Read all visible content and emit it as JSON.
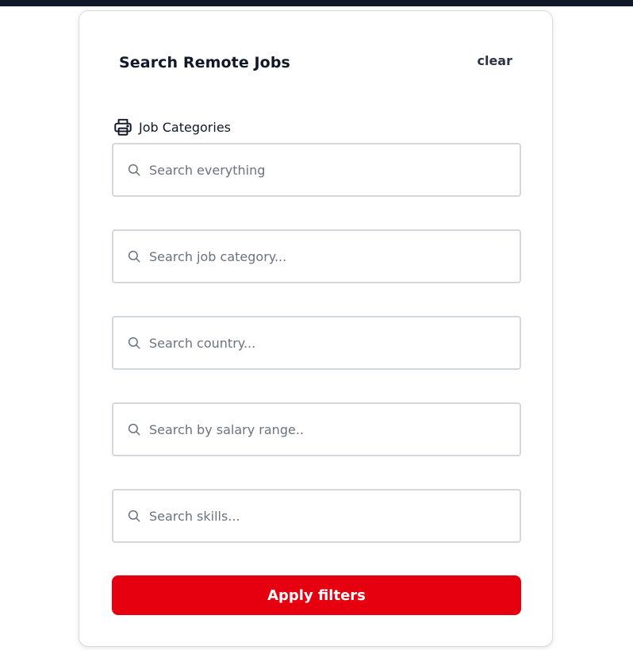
{
  "panel": {
    "title": "Search Remote Jobs",
    "clear_label": "clear"
  },
  "categories": {
    "label": "Job Categories",
    "icon": "printer-icon"
  },
  "fields": [
    {
      "name": "search-everything-input",
      "placeholder": "Search everything",
      "value": "",
      "icon": "search-icon"
    },
    {
      "name": "job-category-input",
      "placeholder": "Search job category...",
      "value": "",
      "icon": "search-icon"
    },
    {
      "name": "country-input",
      "placeholder": "Search country...",
      "value": "",
      "icon": "search-icon"
    },
    {
      "name": "salary-range-input",
      "placeholder": "Search by salary range..",
      "value": "",
      "icon": "search-icon"
    },
    {
      "name": "skills-input",
      "placeholder": "Search skills...",
      "value": "",
      "icon": "search-icon"
    }
  ],
  "actions": {
    "apply_label": "Apply filters"
  },
  "colors": {
    "top_bar": "#111827",
    "apply_button": "#e6000f",
    "field_border": "#d4d7dd"
  }
}
